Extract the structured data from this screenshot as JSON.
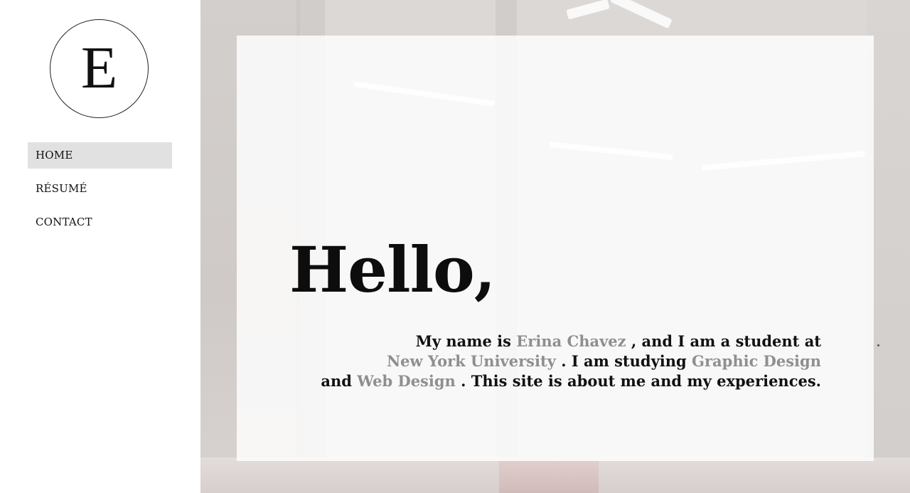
{
  "logo": {
    "letter": "E"
  },
  "nav": {
    "items": [
      {
        "label": "HOME",
        "active": true
      },
      {
        "label": "RÉSUMÉ",
        "active": false
      },
      {
        "label": "CONTACT",
        "active": false
      }
    ]
  },
  "hero": {
    "heading": "Hello,",
    "intro": {
      "p1": "My name is",
      "name": "Erina Chavez",
      "p2": ", and I am a student at",
      "school": "New York University",
      "p3": ". I am studying",
      "major1": "Graphic Design",
      "p4": "and",
      "major2": "Web Design",
      "p5": ". This site is about me and my experiences."
    }
  },
  "colors": {
    "highlight": "#8f8f8f",
    "nav_active_bg": "#e1e1e1",
    "text": "#111111"
  }
}
